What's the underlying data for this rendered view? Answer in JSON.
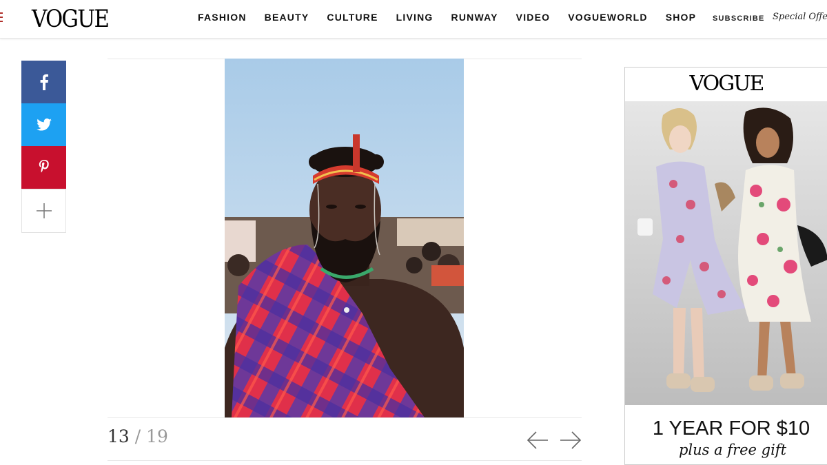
{
  "header": {
    "logo": "VOGUE",
    "nav": [
      "FASHION",
      "BEAUTY",
      "CULTURE",
      "LIVING",
      "RUNWAY",
      "VIDEO",
      "VOGUEWORLD",
      "SHOP"
    ],
    "subscribe": "SUBSCRIBE",
    "special_offer": "Special Offer"
  },
  "share": {
    "icons": [
      "facebook-icon",
      "twitter-icon",
      "pinterest-icon",
      "plus-icon"
    ],
    "colors": {
      "facebook": "#3b5998",
      "twitter": "#1da1f2",
      "pinterest": "#c8102e"
    }
  },
  "gallery": {
    "current": "13",
    "separator": "/",
    "total": "19",
    "prev_icon": "arrow-left-icon",
    "next_icon": "arrow-right-icon"
  },
  "ad": {
    "logo": "VOGUE",
    "headline": "1 YEAR FOR $10",
    "subline": "plus a free gift"
  }
}
